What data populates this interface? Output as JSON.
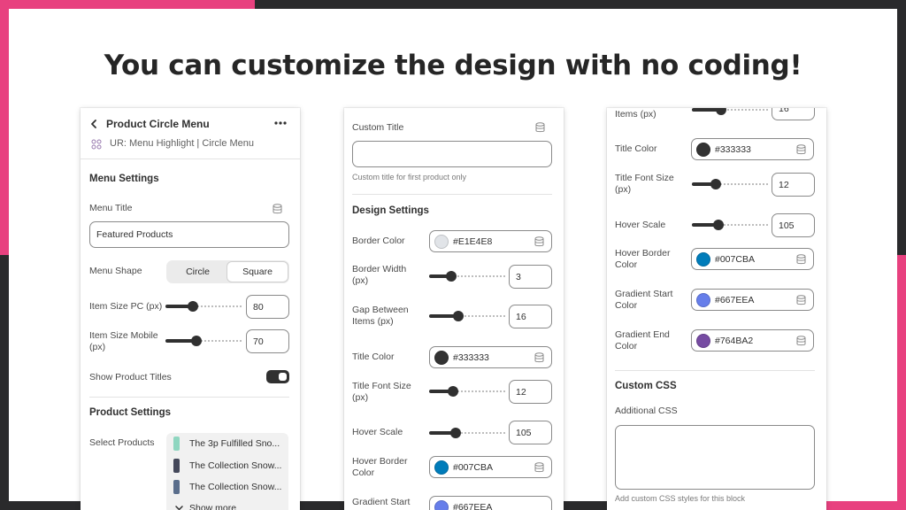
{
  "headline": "You can customize the design with no coding!",
  "colors": {
    "frame_dark": "#2a2a2c",
    "frame_pink": "#e8417f"
  },
  "panel1": {
    "title": "Product Circle Menu",
    "subtitle": "UR: Menu Highlight | Circle Menu",
    "menu_settings_heading": "Menu Settings",
    "menu_title_label": "Menu Title",
    "menu_title_value": "Featured Products",
    "menu_shape_label": "Menu Shape",
    "menu_shape_options": [
      "Circle",
      "Square"
    ],
    "menu_shape_selected": "Square",
    "item_size_pc_label": "Item Size PC (px)",
    "item_size_pc_value": "80",
    "item_size_mobile_label": "Item Size Mobile (px)",
    "item_size_mobile_value": "70",
    "show_titles_label": "Show Product Titles",
    "show_titles_on": true,
    "product_settings_heading": "Product Settings",
    "select_products_label": "Select Products",
    "products": [
      {
        "name": "The 3p Fulfilled Sno...",
        "thumb_color": "#8fd6c0"
      },
      {
        "name": "The Collection Snow...",
        "thumb_color": "#44485a"
      },
      {
        "name": "The Collection Snow...",
        "thumb_color": "#5a6e8c"
      }
    ],
    "show_more": "Show more"
  },
  "panel2": {
    "custom_title_label": "Custom Title",
    "custom_title_value": "",
    "custom_title_hint": "Custom title for first product only",
    "design_heading": "Design Settings",
    "border_color_label": "Border Color",
    "border_color_value": "#E1E4E8",
    "border_width_label": "Border Width (px)",
    "border_width_value": "3",
    "gap_label": "Gap Between Items (px)",
    "gap_value": "16",
    "title_color_label": "Title Color",
    "title_color_value": "#333333",
    "title_font_label": "Title Font Size (px)",
    "title_font_value": "12",
    "hover_scale_label": "Hover Scale",
    "hover_scale_value": "105",
    "hover_border_label": "Hover Border Color",
    "hover_border_value": "#007CBA",
    "gradient_start_label": "Gradient Start",
    "gradient_start_value": "#667EEA"
  },
  "panel3": {
    "items_label": "Items (px)",
    "items_value": "16",
    "title_color_label": "Title Color",
    "title_color_value": "#333333",
    "title_font_label": "Title Font Size (px)",
    "title_font_value": "12",
    "hover_scale_label": "Hover Scale",
    "hover_scale_value": "105",
    "hover_border_label": "Hover Border Color",
    "hover_border_value": "#007CBA",
    "gradient_start_label": "Gradient Start Color",
    "gradient_start_value": "#667EEA",
    "gradient_end_label": "Gradient End Color",
    "gradient_end_value": "#764BA2",
    "custom_css_heading": "Custom CSS",
    "additional_css_label": "Additional CSS",
    "additional_css_value": "",
    "additional_css_hint": "Add custom CSS styles for this block"
  },
  "icons": {
    "back": "chevron-left-icon",
    "more": "more-horizontal-icon",
    "block": "block-grid-icon",
    "database": "database-icon",
    "chevron_down": "chevron-down-icon"
  }
}
